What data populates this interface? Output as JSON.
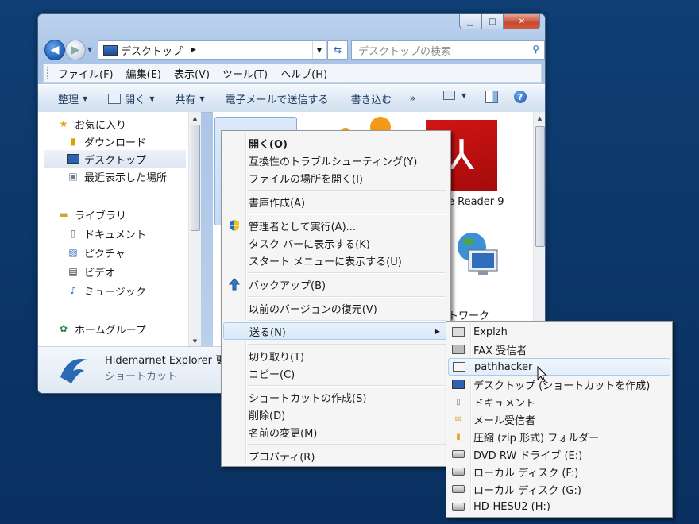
{
  "window": {
    "address_crumb": "デスクトップ",
    "search_placeholder": "デスクトップの検索",
    "controls": {
      "minimize": "▁",
      "maximize": "□",
      "close": "✕"
    }
  },
  "menubar": [
    "ファイル(F)",
    "編集(E)",
    "表示(V)",
    "ツール(T)",
    "ヘルプ(H)"
  ],
  "toolbar": {
    "organize": "整理",
    "open": "開く",
    "share": "共有",
    "email": "電子メールで送信する",
    "burn": "書き込む",
    "more": "»"
  },
  "navpane": {
    "favorites": "お気に入り",
    "downloads": "ダウンロード",
    "desktop": "デスクトップ",
    "recent": "最近表示した場所",
    "libraries": "ライブラリ",
    "documents": "ドキュメント",
    "pictures": "ピクチャ",
    "videos": "ビデオ",
    "music": "ミュージック",
    "homegroup": "ホームグループ"
  },
  "content": {
    "adobe_label": "e Reader 9",
    "network_label": "トワーク"
  },
  "details": {
    "name": "Hidemarnet Explorer",
    "name_suffix": "更",
    "kind": "ショートカット"
  },
  "context_menu": {
    "open": "開く(O)",
    "troubleshoot": "互換性のトラブルシューティング(Y)",
    "open_location": "ファイルの場所を開く(I)",
    "create_archive": "書庫作成(A)",
    "run_as_admin": "管理者として実行(A)...",
    "pin_taskbar": "タスク バーに表示する(K)",
    "pin_start": "スタート メニューに表示する(U)",
    "backup": "バックアップ(B)",
    "restore_prev": "以前のバージョンの復元(V)",
    "send_to": "送る(N)",
    "cut": "切り取り(T)",
    "copy": "コピー(C)",
    "create_shortcut": "ショートカットの作成(S)",
    "delete": "削除(D)",
    "rename": "名前の変更(M)",
    "properties": "プロパティ(R)"
  },
  "sendto_menu": {
    "explzh": "Explzh",
    "fax": "FAX 受信者",
    "pathhacker": "pathhacker",
    "desktop_shortcut": "デスクトップ (ショートカットを作成)",
    "documents": "ドキュメント",
    "mail": "メール受信者",
    "zip": "圧縮 (zip 形式) フォルダー",
    "dvd": "DVD RW ドライブ (E:)",
    "local_f": "ローカル ディスク (F:)",
    "local_g": "ローカル ディスク (G:)",
    "hdhesu": "HD-HESU2 (H:)"
  },
  "colors": {
    "desktop": "#0e3a6e",
    "menu_highlight": "#d9e9fa",
    "adobe_red": "#c41010"
  }
}
